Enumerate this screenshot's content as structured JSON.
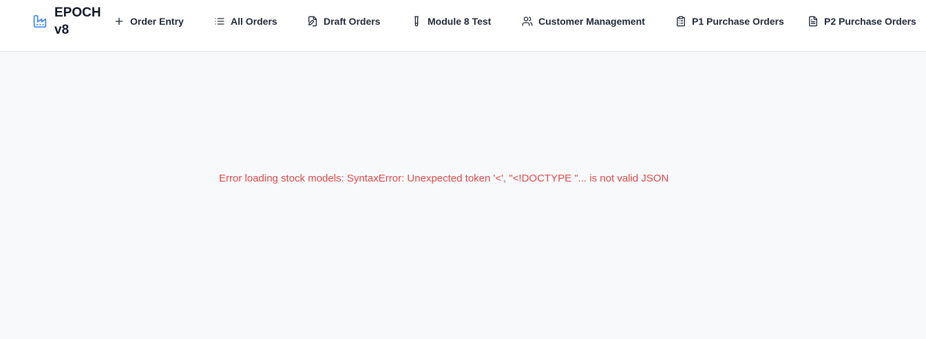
{
  "app": {
    "brand": "EPOCH v8",
    "brand_icon": "factory-icon",
    "accent_color": "#3b82f6"
  },
  "nav": [
    {
      "label": "Order Entry",
      "icon": "plus-icon"
    },
    {
      "label": "All Orders",
      "icon": "list-icon"
    },
    {
      "label": "Draft Orders",
      "icon": "edit-document-icon"
    },
    {
      "label": "Module 8 Test",
      "icon": "test-tube-icon"
    },
    {
      "label": "Customer Management",
      "icon": "users-icon"
    },
    {
      "label": "P1 Purchase Orders",
      "icon": "clipboard-icon"
    },
    {
      "label": "P2 Purchase Orders",
      "icon": "file-text-icon"
    }
  ],
  "main": {
    "error_message": "Error loading stock models: SyntaxError: Unexpected token '<', \"<!DOCTYPE \"... is not valid JSON",
    "error_color": "#e04848"
  }
}
